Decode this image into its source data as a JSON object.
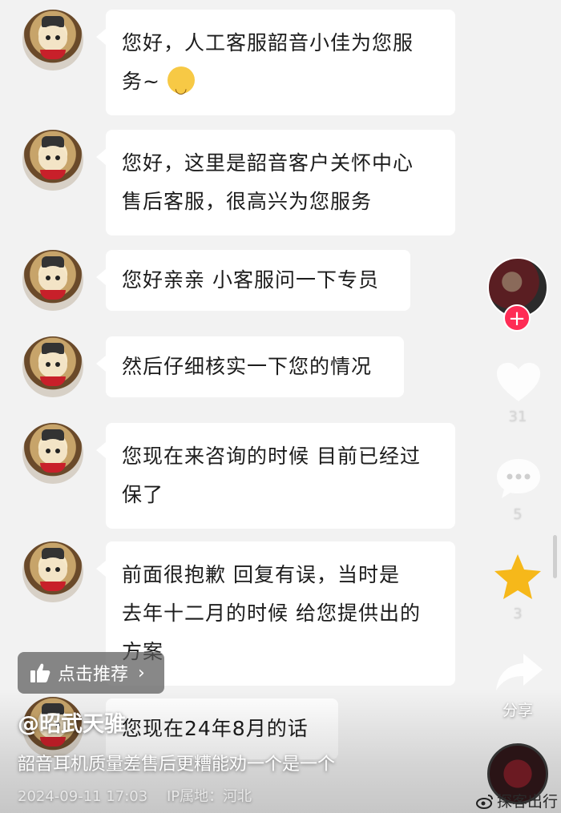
{
  "messages": [
    {
      "lines": [
        "您好，人工客服韶音小佳为您服",
        "务~"
      ],
      "emoji": true
    },
    {
      "lines": [
        "您好，这里是韶音客户关怀中心",
        "售后客服，很高兴为您服务"
      ]
    },
    {
      "lines": [
        "您好亲亲 小客服问一下专员"
      ]
    },
    {
      "lines": [
        "然后仔细核实一下您的情况"
      ]
    },
    {
      "lines": [
        "您现在来咨询的时候 目前已经过",
        "保了"
      ]
    },
    {
      "lines": [
        "前面很抱歉 回复有误，当时是",
        "去年十二月的时候 给您提供出的",
        "方案"
      ]
    },
    {
      "lines": [
        "您现在24年8月的话"
      ]
    }
  ],
  "sidebar": {
    "follow_label": "+",
    "like_count": "31",
    "comment_count": "5",
    "favorite_count": "3",
    "share_label": "分享",
    "colors": {
      "follow": "#fe2c55",
      "star": "#f6b81a"
    }
  },
  "recommend": {
    "label": "点击推荐"
  },
  "post": {
    "username": "@昭武天骓",
    "caption": "韶音耳机质量差售后更糟能劝一个是一个",
    "date": "2024-09-11 17:03",
    "ip_location": "IP属地：河北"
  },
  "watermark": {
    "text": "探客出行"
  }
}
